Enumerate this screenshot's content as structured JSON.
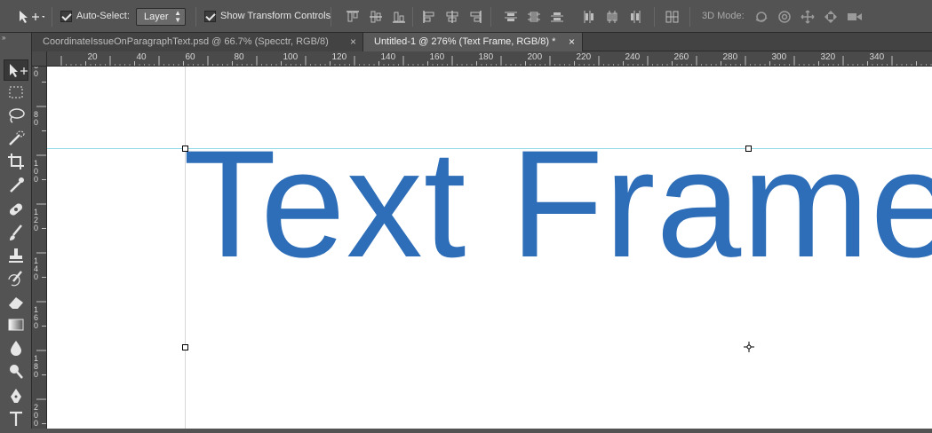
{
  "options": {
    "auto_select_label": "Auto-Select:",
    "auto_select_checked": true,
    "layer_select_value": "Layer",
    "show_transform_label": "Show Transform Controls",
    "show_transform_checked": true,
    "mode_3d_label": "3D Mode:"
  },
  "tabs": [
    {
      "label": "CoordinateIssueOnParagraphText.psd @ 66.7% (Specctr, RGB/8)",
      "close": "×",
      "active": false
    },
    {
      "label": "Untitled-1 @ 276% (Text Frame, RGB/8) *",
      "close": "×",
      "active": true
    }
  ],
  "ruler_h_ticks": [
    "20",
    "40",
    "60",
    "80",
    "100",
    "120",
    "140",
    "160",
    "180",
    "200",
    "220",
    "240",
    "260",
    "280",
    "300",
    "320",
    "340"
  ],
  "ruler_v_ticks": [
    "6 0",
    "8 0",
    "1 0 0",
    "1 2 0",
    "1 4 0",
    "1 6 0",
    "1 8 0",
    "2 0 0"
  ],
  "canvas": {
    "text_frame_content": "Text Frame",
    "text_color": "#2e6eb8"
  },
  "tools": [
    "move-icon",
    "marquee-icon",
    "lasso-icon",
    "quick-selection-icon",
    "crop-icon",
    "eyedropper-icon",
    "healing-brush-icon",
    "brush-icon",
    "clone-stamp-icon",
    "history-brush-icon",
    "eraser-icon",
    "gradient-icon",
    "blur-icon",
    "dodge-icon",
    "pen-icon",
    "type-icon"
  ]
}
